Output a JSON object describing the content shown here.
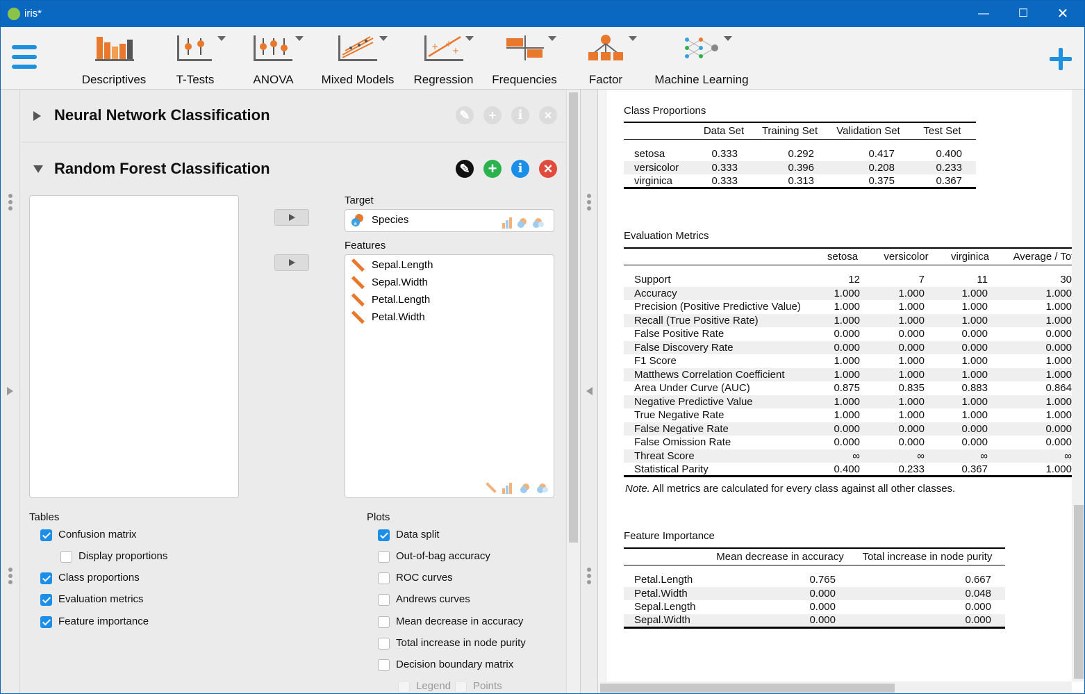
{
  "app": {
    "title": "iris*"
  },
  "colors": {
    "titlebar": "#0a68c1",
    "accent": "#1b8ee8",
    "add": "#2bb24c",
    "close": "#e14b3b"
  },
  "ribbon": {
    "menu_icon": "hamburger-icon",
    "modules": [
      {
        "label": "Descriptives",
        "icon": "descriptives-icon",
        "has_dropdown": false
      },
      {
        "label": "T-Tests",
        "icon": "t-tests-icon",
        "has_dropdown": true
      },
      {
        "label": "ANOVA",
        "icon": "anova-icon",
        "has_dropdown": true
      },
      {
        "label": "Mixed Models",
        "icon": "mixed-models-icon",
        "has_dropdown": true
      },
      {
        "label": "Regression",
        "icon": "regression-icon",
        "has_dropdown": true
      },
      {
        "label": "Frequencies",
        "icon": "frequencies-icon",
        "has_dropdown": true
      },
      {
        "label": "Factor",
        "icon": "factor-icon",
        "has_dropdown": true
      },
      {
        "label": "Machine Learning",
        "icon": "machine-learning-icon",
        "has_dropdown": true
      }
    ],
    "add_icon": "plus-icon"
  },
  "analyses": [
    {
      "title": "Neural Network Classification",
      "expanded": false
    },
    {
      "title": "Random Forest Classification",
      "expanded": true
    }
  ],
  "form": {
    "target_label": "Target",
    "target_var": "Species",
    "features_label": "Features",
    "features": [
      "Sepal.Length",
      "Sepal.Width",
      "Petal.Length",
      "Petal.Width"
    ],
    "tables_label": "Tables",
    "tables": [
      {
        "label": "Confusion matrix",
        "checked": true,
        "indent": 0
      },
      {
        "label": "Display proportions",
        "checked": false,
        "indent": 1
      },
      {
        "label": "Class proportions",
        "checked": true,
        "indent": 0
      },
      {
        "label": "Evaluation metrics",
        "checked": true,
        "indent": 0
      },
      {
        "label": "Feature importance",
        "checked": true,
        "indent": 0
      }
    ],
    "plots_label": "Plots",
    "plots": [
      {
        "label": "Data split",
        "checked": true
      },
      {
        "label": "Out-of-bag accuracy",
        "checked": false
      },
      {
        "label": "ROC curves",
        "checked": false
      },
      {
        "label": "Andrews curves",
        "checked": false
      },
      {
        "label": "Mean decrease in accuracy",
        "checked": false
      },
      {
        "label": "Total increase in node purity",
        "checked": false
      },
      {
        "label": "Decision boundary matrix",
        "checked": false
      }
    ],
    "sub_options": [
      {
        "label": "Legend",
        "checked": true,
        "disabled": true
      },
      {
        "label": "Points",
        "checked": true,
        "disabled": true
      }
    ]
  },
  "results": {
    "class_proportions": {
      "title": "Class Proportions",
      "columns": [
        "",
        "Data Set",
        "Training Set",
        "Validation Set",
        "Test Set"
      ],
      "rows": [
        [
          "setosa",
          "0.333",
          "0.292",
          "0.417",
          "0.400"
        ],
        [
          "versicolor",
          "0.333",
          "0.396",
          "0.208",
          "0.233"
        ],
        [
          "virginica",
          "0.333",
          "0.313",
          "0.375",
          "0.367"
        ]
      ]
    },
    "evaluation_metrics": {
      "title": "Evaluation Metrics",
      "columns": [
        "",
        "setosa",
        "versicolor",
        "virginica",
        "Average / Tot"
      ],
      "rows": [
        [
          "Support",
          "12",
          "7",
          "11",
          "30"
        ],
        [
          "Accuracy",
          "1.000",
          "1.000",
          "1.000",
          "1.000"
        ],
        [
          "Precision (Positive Predictive Value)",
          "1.000",
          "1.000",
          "1.000",
          "1.000"
        ],
        [
          "Recall (True Positive Rate)",
          "1.000",
          "1.000",
          "1.000",
          "1.000"
        ],
        [
          "False Positive Rate",
          "0.000",
          "0.000",
          "0.000",
          "0.000"
        ],
        [
          "False Discovery Rate",
          "0.000",
          "0.000",
          "0.000",
          "0.000"
        ],
        [
          "F1 Score",
          "1.000",
          "1.000",
          "1.000",
          "1.000"
        ],
        [
          "Matthews Correlation Coefficient",
          "1.000",
          "1.000",
          "1.000",
          "1.000"
        ],
        [
          "Area Under Curve (AUC)",
          "0.875",
          "0.835",
          "0.883",
          "0.864"
        ],
        [
          "Negative Predictive Value",
          "1.000",
          "1.000",
          "1.000",
          "1.000"
        ],
        [
          "True Negative Rate",
          "1.000",
          "1.000",
          "1.000",
          "1.000"
        ],
        [
          "False Negative Rate",
          "0.000",
          "0.000",
          "0.000",
          "0.000"
        ],
        [
          "False Omission Rate",
          "0.000",
          "0.000",
          "0.000",
          "0.000"
        ],
        [
          "Threat Score",
          "∞",
          "∞",
          "∞",
          "∞"
        ],
        [
          "Statistical Parity",
          "0.400",
          "0.233",
          "0.367",
          "1.000"
        ]
      ],
      "note_prefix": "Note.",
      "note_text": " All metrics are calculated for every class against all other classes."
    },
    "feature_importance": {
      "title": "Feature Importance",
      "columns": [
        "",
        "Mean decrease in accuracy",
        "Total increase in node purity"
      ],
      "rows": [
        [
          "Petal.Length",
          "0.765",
          "0.667"
        ],
        [
          "Petal.Width",
          "0.000",
          "0.048"
        ],
        [
          "Sepal.Length",
          "0.000",
          "0.000"
        ],
        [
          "Sepal.Width",
          "0.000",
          "0.000"
        ]
      ]
    }
  }
}
